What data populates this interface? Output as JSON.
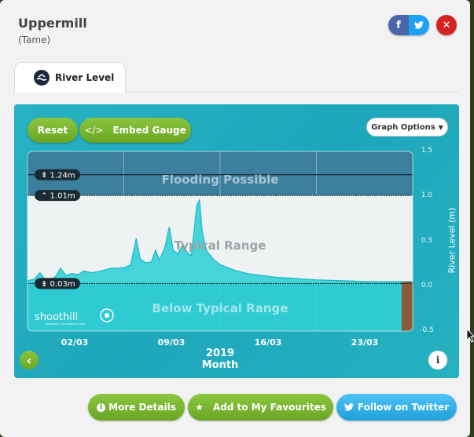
{
  "station": {
    "name": "Uppermill",
    "river": "(Tame)"
  },
  "share": {
    "facebook_label": "f"
  },
  "tabs": [
    {
      "label": "River Level",
      "icon": "river-level-icon"
    }
  ],
  "toolbar": {
    "reset_label": "Reset",
    "embed_label": "Embed Gauge",
    "graph_options_label": "Graph Options"
  },
  "chart_data": {
    "type": "area",
    "ylabel": "River Level (m)",
    "ylim": [
      -0.5,
      1.5
    ],
    "yticks": [
      "1.5",
      "1.0",
      "0.5",
      "0.0",
      "-0.5"
    ],
    "xticks": [
      "02/03",
      "09/03",
      "16/03",
      "23/03"
    ],
    "xlabel_year": "2019",
    "xlabel_unit": "Month",
    "bands": [
      {
        "label": "Flooding Possible",
        "from": 1.01,
        "to": 1.5
      },
      {
        "label": "Typical Range",
        "from": 0.03,
        "to": 1.01
      },
      {
        "label": "Below Typical Range",
        "from": -0.5,
        "to": 0.03
      }
    ],
    "thresholds": [
      {
        "label": "1.24m",
        "value": 1.24
      },
      {
        "label": "1.01m",
        "value": 1.01
      },
      {
        "label": "0.03m",
        "value": 0.03
      }
    ],
    "series": [
      {
        "color": "#33d0d8",
        "points": [
          [
            0,
            0.06
          ],
          [
            0.5,
            0.08
          ],
          [
            0.9,
            0.15
          ],
          [
            1.2,
            0.09
          ],
          [
            1.6,
            0.08
          ],
          [
            2.0,
            0.1
          ],
          [
            2.4,
            0.2
          ],
          [
            2.8,
            0.12
          ],
          [
            3.2,
            0.14
          ],
          [
            3.7,
            0.13
          ],
          [
            4.1,
            0.17
          ],
          [
            4.6,
            0.15
          ],
          [
            5.1,
            0.16
          ],
          [
            5.6,
            0.18
          ],
          [
            6.1,
            0.2
          ],
          [
            6.6,
            0.2
          ],
          [
            7.1,
            0.21
          ],
          [
            7.5,
            0.24
          ],
          [
            7.9,
            0.53
          ],
          [
            8.2,
            0.3
          ],
          [
            8.6,
            0.26
          ],
          [
            9.0,
            0.27
          ],
          [
            9.3,
            0.4
          ],
          [
            9.6,
            0.29
          ],
          [
            10.0,
            0.44
          ],
          [
            10.3,
            0.66
          ],
          [
            10.6,
            0.4
          ],
          [
            10.9,
            0.36
          ],
          [
            11.3,
            0.46
          ],
          [
            11.6,
            0.38
          ],
          [
            11.9,
            0.34
          ],
          [
            12.1,
            0.6
          ],
          [
            12.3,
            0.9
          ],
          [
            12.5,
            0.96
          ],
          [
            12.7,
            0.6
          ],
          [
            13.0,
            0.4
          ],
          [
            13.5,
            0.3
          ],
          [
            14.0,
            0.24
          ],
          [
            15.0,
            0.18
          ],
          [
            16.0,
            0.14
          ],
          [
            17.0,
            0.12
          ],
          [
            18.0,
            0.1
          ],
          [
            19.0,
            0.09
          ],
          [
            20.0,
            0.08
          ],
          [
            21.0,
            0.07
          ],
          [
            22.0,
            0.065
          ],
          [
            23.0,
            0.06
          ],
          [
            24.0,
            0.055
          ],
          [
            25.0,
            0.05
          ],
          [
            26.0,
            0.05
          ],
          [
            27.0,
            0.05
          ],
          [
            28.0,
            0.05
          ]
        ]
      }
    ]
  },
  "watermark": {
    "brand": "shoothill",
    "tagline": "UNLOCKING THE POWER OF DATA"
  },
  "footer": {
    "more_details": "More Details",
    "favourites": "Add to My Favourites",
    "twitter": "Follow on Twitter"
  }
}
